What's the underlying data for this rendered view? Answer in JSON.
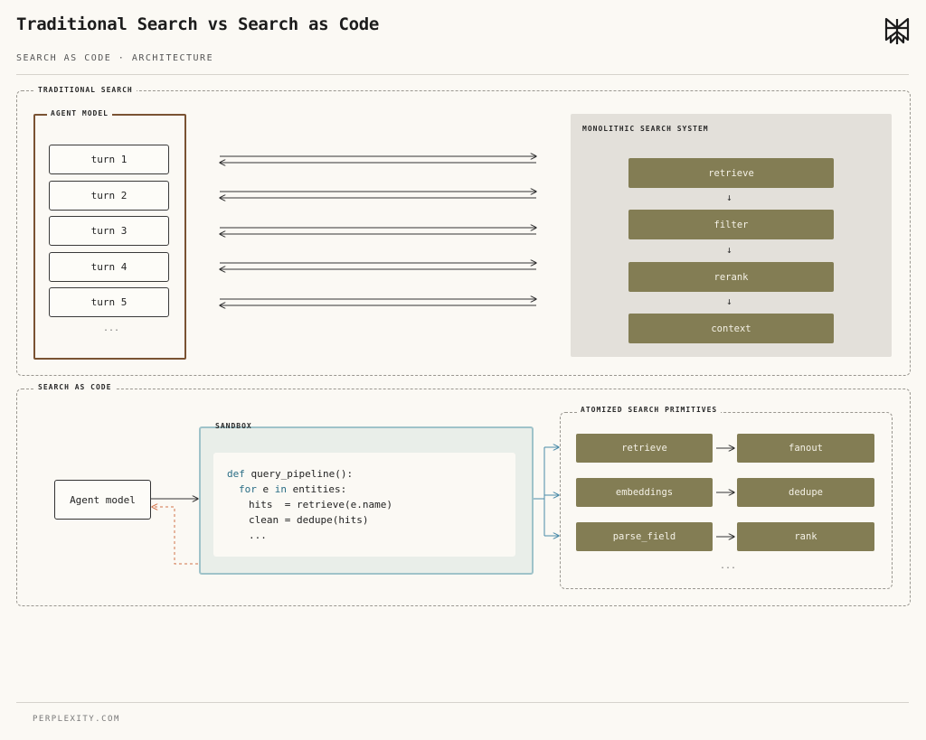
{
  "header": {
    "title": "Traditional Search vs Search as Code",
    "subtitle": "SEARCH AS CODE · ARCHITECTURE"
  },
  "footer": {
    "text": "PERPLEXITY.COM"
  },
  "traditional": {
    "section_label": "TRADITIONAL SEARCH",
    "agent_label": "AGENT MODEL",
    "turns": [
      "turn 1",
      "turn 2",
      "turn 3",
      "turn 4",
      "turn 5"
    ],
    "turns_ellipsis": "...",
    "system_label": "MONOLITHIC SEARCH SYSTEM",
    "steps": [
      "retrieve",
      "filter",
      "rerank",
      "context"
    ],
    "step_arrow": "↓"
  },
  "sac": {
    "section_label": "SEARCH AS CODE",
    "agent_model": "Agent model",
    "sandbox_label": "SANDBOX",
    "code": {
      "line1_kw": "def",
      "line1_rest": " query_pipeline():",
      "line2_kw1": "for",
      "line2_mid": " e ",
      "line2_kw2": "in",
      "line2_rest": " entities:",
      "line3": "hits  = retrieve(e.name)",
      "line4": "clean = dedupe(hits)",
      "line5": "..."
    },
    "primitives_label": "ATOMIZED SEARCH PRIMITIVES",
    "primitive_rows": [
      {
        "left": "retrieve",
        "right": "fanout"
      },
      {
        "left": "embeddings",
        "right": "dedupe"
      },
      {
        "left": "parse_field",
        "right": "rank"
      }
    ],
    "primitives_ellipsis": "..."
  },
  "colors": {
    "olive": "#837d54",
    "agent_border": "#7a5333",
    "sandbox_border": "#9fc3c9",
    "sandbox_fill": "#e9eee9",
    "feedback_arrow": "#d2734a",
    "link_arrow": "#4a8aa8",
    "keyword": "#2a6d85"
  },
  "icons": {
    "logo": "perplexity-logo-icon"
  }
}
